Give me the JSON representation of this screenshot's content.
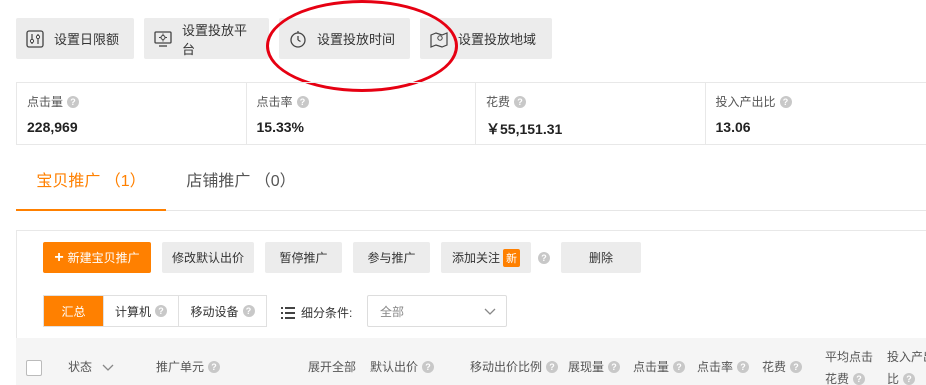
{
  "toolbar": {
    "buttons": [
      {
        "label": "设置日限额",
        "icon": "sliders-icon"
      },
      {
        "label": "设置投放平台",
        "icon": "monitor-icon"
      },
      {
        "label": "设置投放时间",
        "icon": "clock-icon"
      },
      {
        "label": "设置投放地域",
        "icon": "map-icon"
      }
    ]
  },
  "annotation": {
    "color": "#e60012"
  },
  "stats": [
    {
      "label": "点击量",
      "value": "228,969"
    },
    {
      "label": "点击率",
      "value": "15.33%"
    },
    {
      "label": "花费",
      "value": "￥55,151.31"
    },
    {
      "label": "投入产出比",
      "value": "13.06"
    }
  ],
  "tabs": [
    {
      "label": "宝贝推广 （1）",
      "active": true
    },
    {
      "label": "店铺推广 （0）",
      "active": false
    }
  ],
  "actions": {
    "new": "新建宝贝推广",
    "modify_bid": "修改默认出价",
    "pause": "暂停推广",
    "join": "参与推广",
    "follow": "添加关注",
    "new_badge": "新",
    "delete": "删除"
  },
  "segments": [
    "汇总",
    "计算机",
    "移动设备"
  ],
  "filter": {
    "label": "细分条件:",
    "select_value": "全部"
  },
  "table_header": {
    "status": "状态",
    "unit": "推广单元",
    "expand": "展开全部",
    "default_bid": "默认出价",
    "mobile_ratio": "移动出价比例",
    "impressions": "展现量",
    "clicks": "点击量",
    "ctr": "点击率",
    "cost": "花费",
    "avg_cpc_1": "平均点击",
    "avg_cpc_2": "花费",
    "roi_1": "投入产出",
    "roi_2": "比"
  },
  "colors": {
    "accent": "#ff8000",
    "button_bg": "#ececec"
  }
}
